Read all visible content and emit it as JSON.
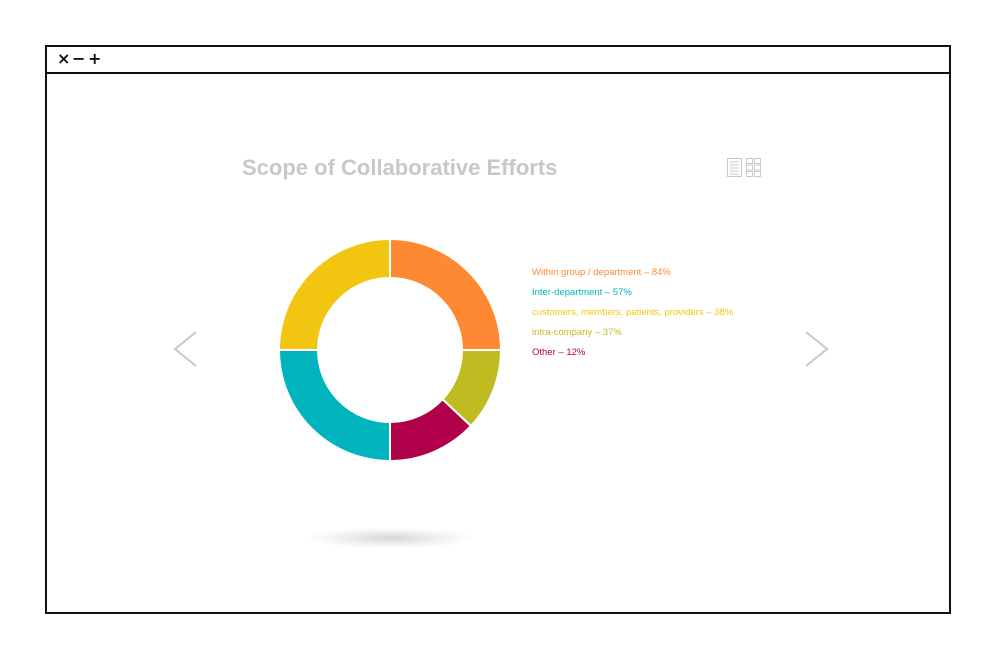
{
  "window": {
    "close_label": "×",
    "minimize_label": "−",
    "maximize_label": "+"
  },
  "icons": {
    "list_view": "list-view-icon",
    "grid_view": "grid-view-icon",
    "prev": "chevron-left-icon",
    "next": "chevron-right-icon"
  },
  "chart_data": {
    "type": "pie",
    "title": "Scope of Collaborative Efforts",
    "donut": true,
    "legend_placement": "right",
    "segments": [
      {
        "label": "Within group / department – 84%",
        "value": 25,
        "color": "#ff8833"
      },
      {
        "label": "Inter-department – 57%",
        "value": 25,
        "color": "#00b3bc"
      },
      {
        "label": "customers, members, patients, providers – 38%",
        "value": 25,
        "color": "#f2c511"
      },
      {
        "label": "intra-company – 37%",
        "value": 12,
        "color": "#bfbc22"
      },
      {
        "label": "Other – 12%",
        "value": 13,
        "color": "#b0004a"
      }
    ],
    "draw_order": [
      0,
      3,
      4,
      1,
      2
    ]
  }
}
